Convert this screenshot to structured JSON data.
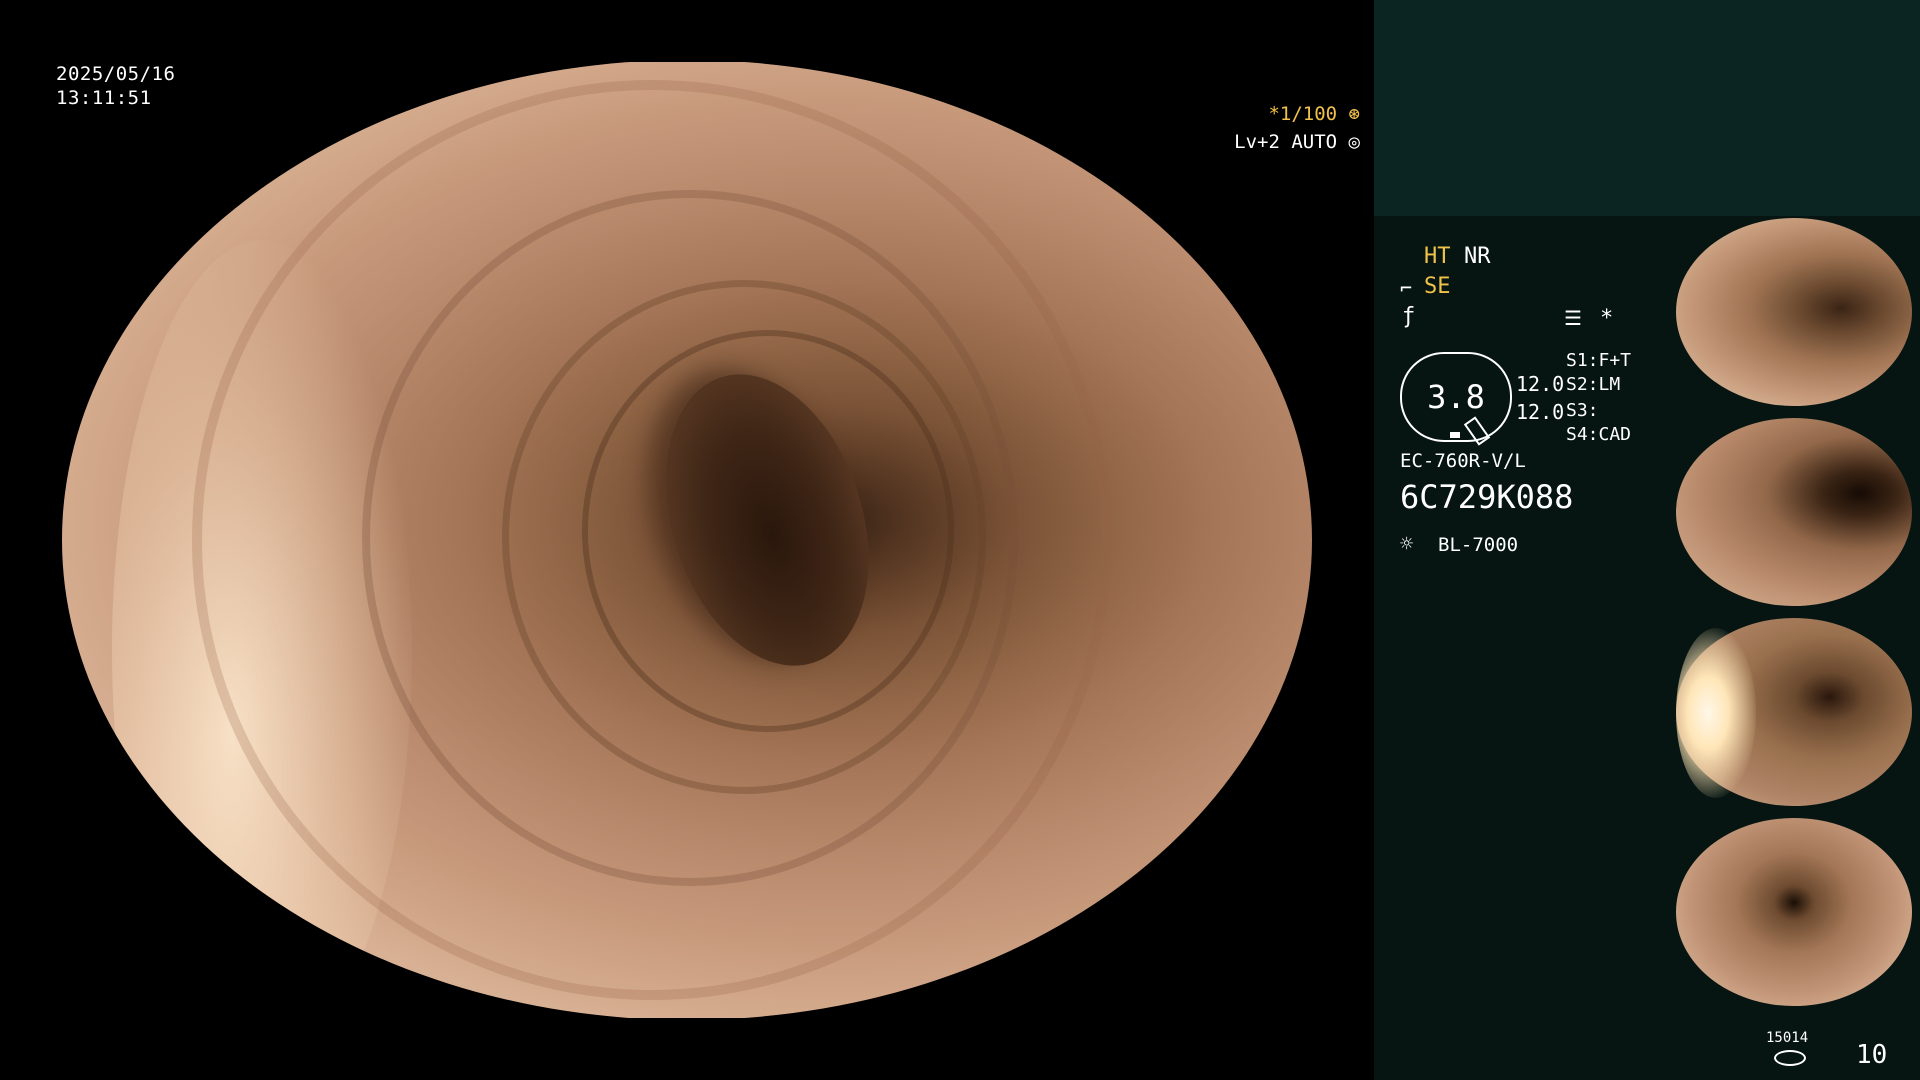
{
  "overlay": {
    "date": "2025/05/16",
    "time": "13:11:51",
    "shutter": "*1/100",
    "level": "Lv+2 AUTO"
  },
  "panel": {
    "ht": "HT",
    "nr": "NR",
    "se": "SE",
    "magnification": "3.8",
    "value_1": "12.0",
    "value_2": "12.0",
    "s1": "S1:F+T",
    "s2": "S2:LM",
    "s3": "S3:",
    "s4": "S4:CAD",
    "scope_model": "EC-760R-V/L",
    "serial": "6C729K088",
    "light_source": "BL-7000",
    "star": "*"
  },
  "thumbnails": [
    {
      "label": "Captured image 1"
    },
    {
      "label": "Captured image 2"
    },
    {
      "label": "Captured image 3"
    },
    {
      "label": "Captured image 4"
    }
  ],
  "footer": {
    "storage_count": "15014",
    "image_count": "10"
  },
  "icons": {
    "shutter_icon": "aperture-icon",
    "auto_icon": "auto-exposure-icon",
    "light_icon": "sun-icon"
  }
}
